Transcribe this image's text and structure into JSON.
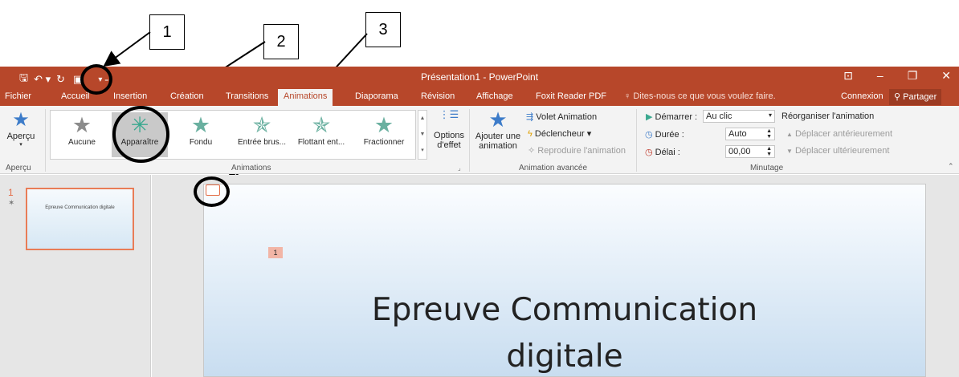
{
  "callouts": [
    "1",
    "2",
    "3"
  ],
  "titlebar": {
    "title": "Présentation1 - PowerPoint"
  },
  "tabs": [
    "Fichier",
    "Accueil",
    "Insertion",
    "Création",
    "Transitions",
    "Animations",
    "Diaporama",
    "Révision",
    "Affichage",
    "Foxit Reader PDF"
  ],
  "active_tab": "Animations",
  "tell_me": "Dites-nous ce que vous voulez faire.",
  "login": "Connexion",
  "share": "Partager",
  "ribbon": {
    "preview_label": "Aperçu",
    "preview_group": "Aperçu",
    "gallery_items": [
      "Aucune",
      "Apparaître",
      "Fondu",
      "Entrée brus...",
      "Flottant ent...",
      "Fractionner"
    ],
    "effect_options": "Options",
    "effect_options_2": "d'effet",
    "animations_group": "Animations",
    "add_animation": "Ajouter une",
    "add_animation_2": "animation",
    "animation_pane": "Volet Animation",
    "trigger": "Déclencheur",
    "painter": "Reproduire l'animation",
    "advanced_group": "Animation avancée",
    "start_label": "Démarrer :",
    "start_value": "Au clic",
    "duration_label": "Durée :",
    "duration_value": "Auto",
    "delay_label": "Délai :",
    "delay_value": "00,00",
    "reorder_label": "Réorganiser l'animation",
    "move_earlier": "Déplacer antérieurement",
    "move_later": "Déplacer ultérieurement",
    "timing_group": "Minutage"
  },
  "thumbnail": {
    "number": "1",
    "text": "Epreuve Communication digitale"
  },
  "slide": {
    "title_line1": "Epreuve Communication",
    "title_line2": "digitale",
    "anim_tag": "1"
  },
  "colors": {
    "accent": "#b7472a",
    "ribbon_bg": "#f3f3f3",
    "highlight": "#e97c56"
  }
}
